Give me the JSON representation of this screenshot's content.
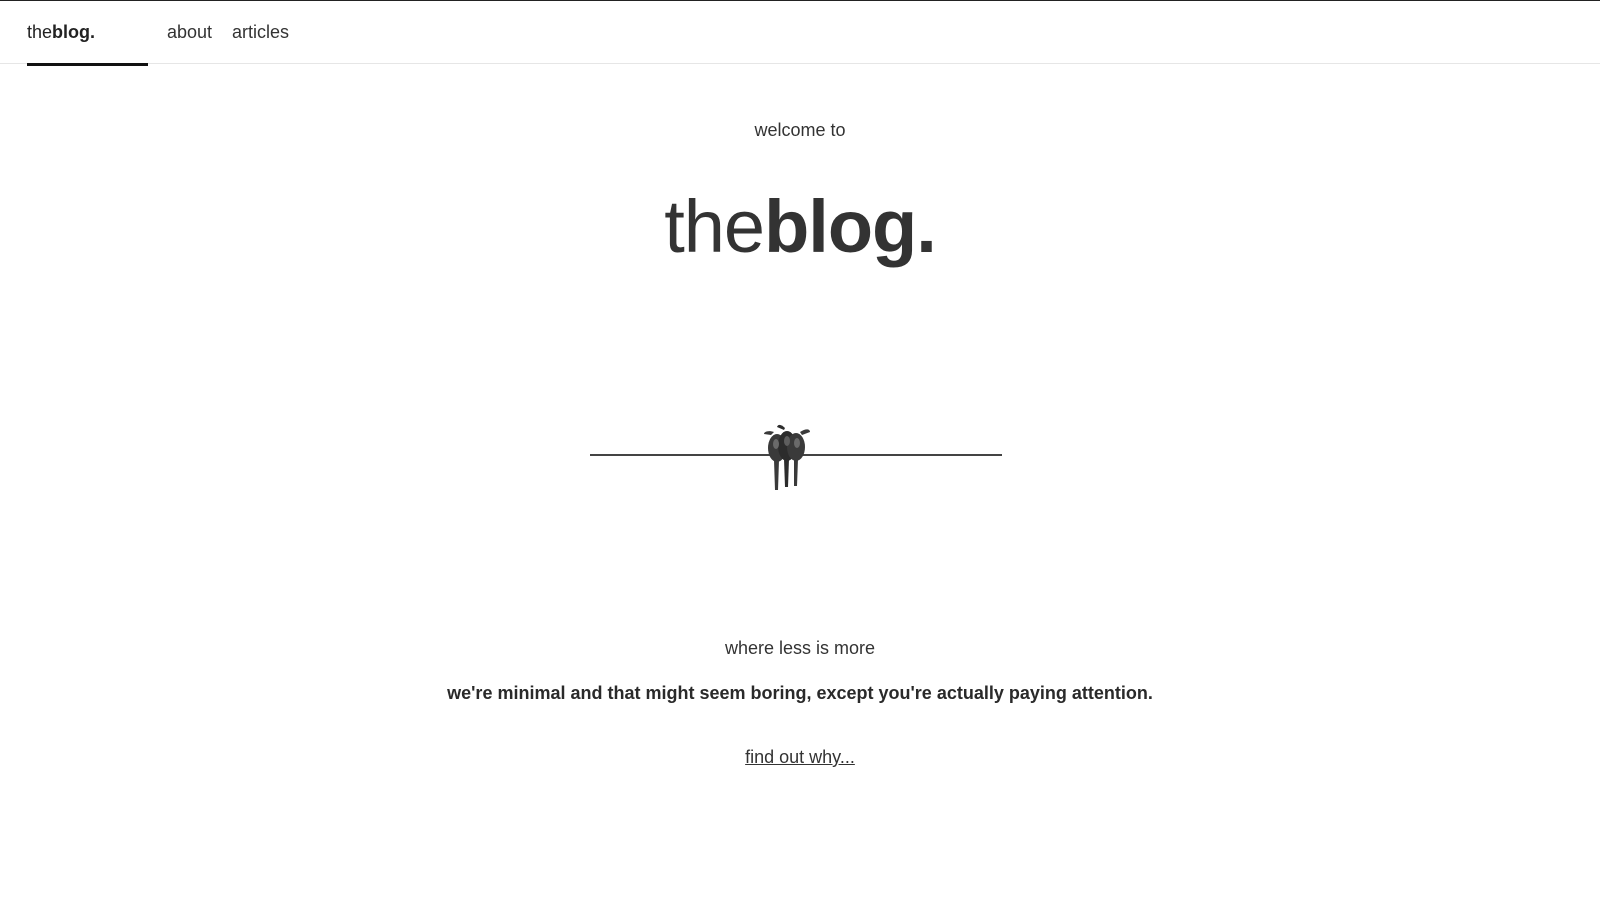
{
  "nav": {
    "brand": {
      "light": "the",
      "bold": "blog."
    },
    "links": [
      {
        "label": "about"
      },
      {
        "label": "articles"
      }
    ]
  },
  "hero": {
    "welcome": "welcome to",
    "title": {
      "light": "the",
      "bold": "blog."
    }
  },
  "illustration": {
    "icon": "birds-on-wire-icon"
  },
  "content": {
    "tagline": "where less is more",
    "description": "we're minimal and that might seem boring, except you're actually paying attention.",
    "cta": "find out why..."
  }
}
